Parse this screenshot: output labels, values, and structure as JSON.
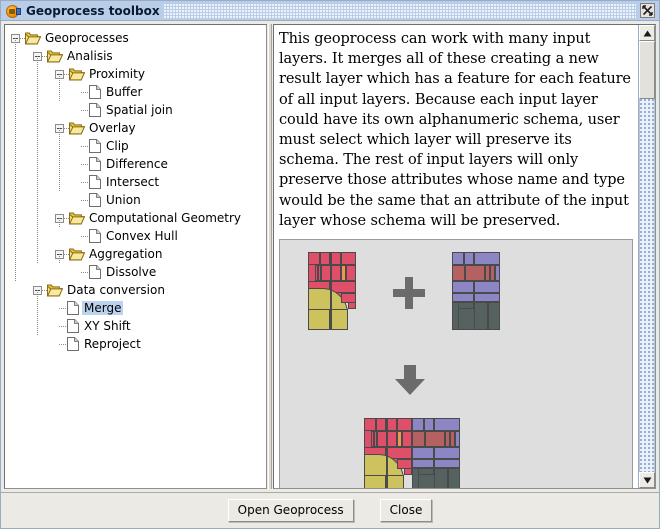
{
  "window": {
    "title": "Geoprocess toolbox",
    "icon": "geoprocess-globe-icon",
    "close_label": "×"
  },
  "tree": {
    "selected": "Merge",
    "items": [
      {
        "label": "Geoprocesses",
        "depth": 0,
        "type": "folder",
        "expanded": true
      },
      {
        "label": "Analisis",
        "depth": 1,
        "type": "folder",
        "expanded": true
      },
      {
        "label": "Proximity",
        "depth": 2,
        "type": "folder",
        "expanded": true
      },
      {
        "label": "Buffer",
        "depth": 3,
        "type": "file"
      },
      {
        "label": "Spatial join",
        "depth": 3,
        "type": "file"
      },
      {
        "label": "Overlay",
        "depth": 2,
        "type": "folder",
        "expanded": true
      },
      {
        "label": "Clip",
        "depth": 3,
        "type": "file"
      },
      {
        "label": "Difference",
        "depth": 3,
        "type": "file"
      },
      {
        "label": "Intersect",
        "depth": 3,
        "type": "file"
      },
      {
        "label": "Union",
        "depth": 3,
        "type": "file"
      },
      {
        "label": "Computational Geometry",
        "depth": 2,
        "type": "folder",
        "expanded": true
      },
      {
        "label": "Convex Hull",
        "depth": 3,
        "type": "file"
      },
      {
        "label": "Aggregation",
        "depth": 2,
        "type": "folder",
        "expanded": true
      },
      {
        "label": "Dissolve",
        "depth": 3,
        "type": "file"
      },
      {
        "label": "Data conversion",
        "depth": 1,
        "type": "folder",
        "expanded": true
      },
      {
        "label": "Merge",
        "depth": 2,
        "type": "file",
        "selected": true
      },
      {
        "label": "XY Shift",
        "depth": 2,
        "type": "file"
      },
      {
        "label": "Reproject",
        "depth": 2,
        "type": "file"
      }
    ]
  },
  "description": {
    "text": "This geoprocess can work with many input layers. It merges all of these creating a new result layer which has a feature for each feature of all input layers. Because each input layer could have its own alphanumeric schema, user must select which layer will preserve its schema. The rest of input layers will only preserve those attributes whose name and type would be the same that an attribute of the input layer whose schema will be preserved."
  },
  "figure": {
    "alt": "merge-operation-diagram",
    "operator": "plus",
    "result_arrow": "down-arrow",
    "colors": {
      "input_a_top": "#e04f69",
      "input_a_bottom": "#cdc25e",
      "input_a_accent": "#f0954f",
      "input_b_top": "#8c87c4",
      "input_b_mid": "#b56161",
      "input_b_bottom": "#56625f",
      "stroke": "#4a4a4a",
      "canvas": "#dedede",
      "arrow": "#6b6b6b"
    }
  },
  "scrollbar": {
    "up_arrow": "scroll-up-icon",
    "down_arrow": "scroll-down-icon",
    "orientation": "vertical"
  },
  "buttons": {
    "open": "Open Geoprocess",
    "close": "Close"
  }
}
